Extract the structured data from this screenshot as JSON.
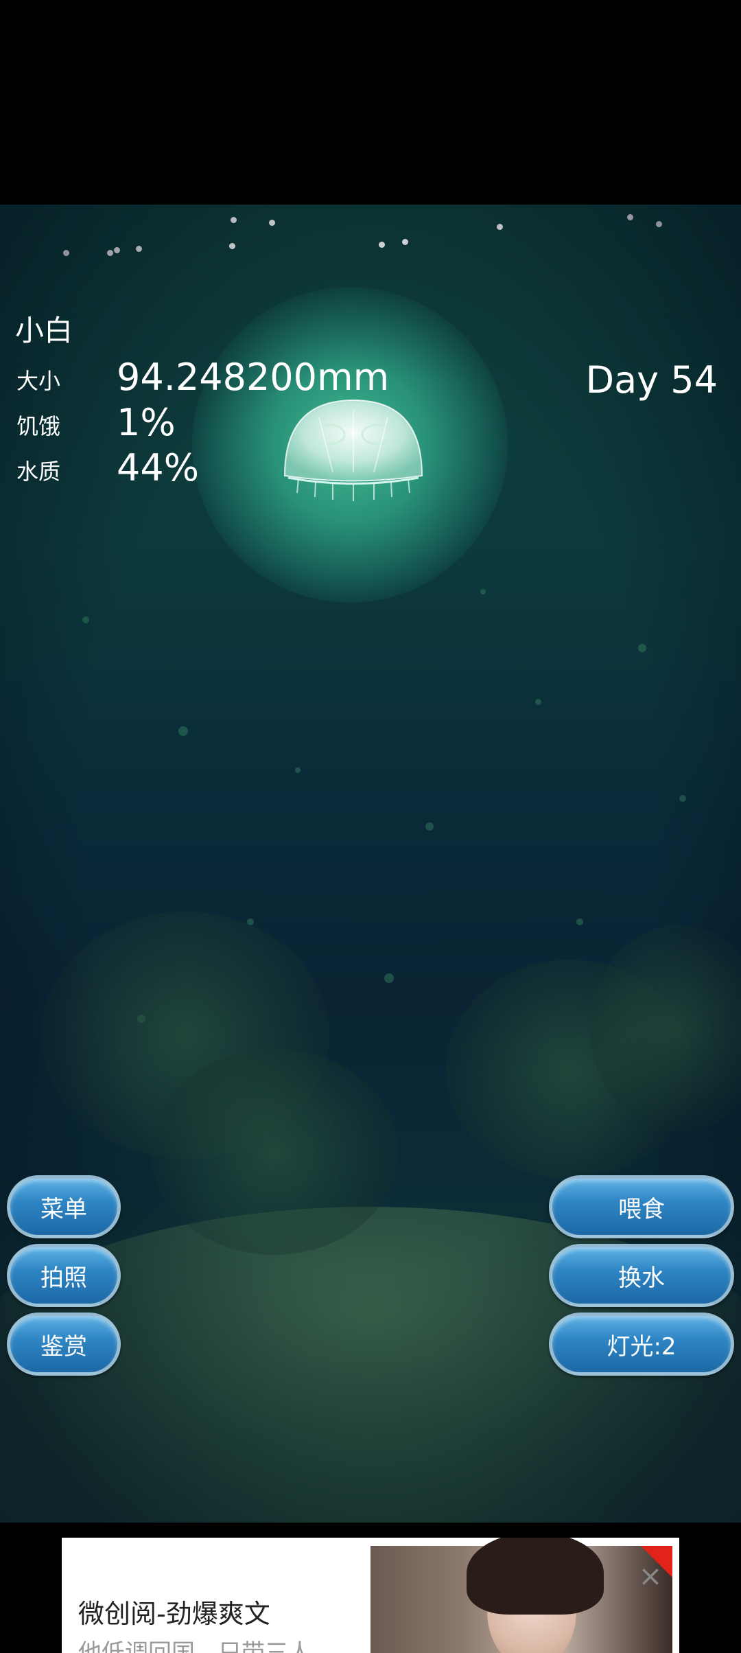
{
  "pet": {
    "name": "小白",
    "day": "Day 54",
    "stats": [
      {
        "label": "大小",
        "value": "94.248200mm"
      },
      {
        "label": "饥饿",
        "value": "1%"
      },
      {
        "label": "水质",
        "value": "44%"
      }
    ]
  },
  "buttons": {
    "menu": "菜单",
    "photo": "拍照",
    "appreciate": "鉴赏",
    "feed": "喂食",
    "change_water": "换水",
    "light": "灯光:2"
  },
  "ad": {
    "title": "微创阅-劲爆爽文",
    "subtitle": "他低调回国，只带三人…",
    "close_icon": "close-icon"
  },
  "colors": {
    "button_top": "#5fb3e6",
    "button_bottom": "#1d68a6",
    "water_top": "#0f3f3b",
    "glow": "#46be96"
  }
}
